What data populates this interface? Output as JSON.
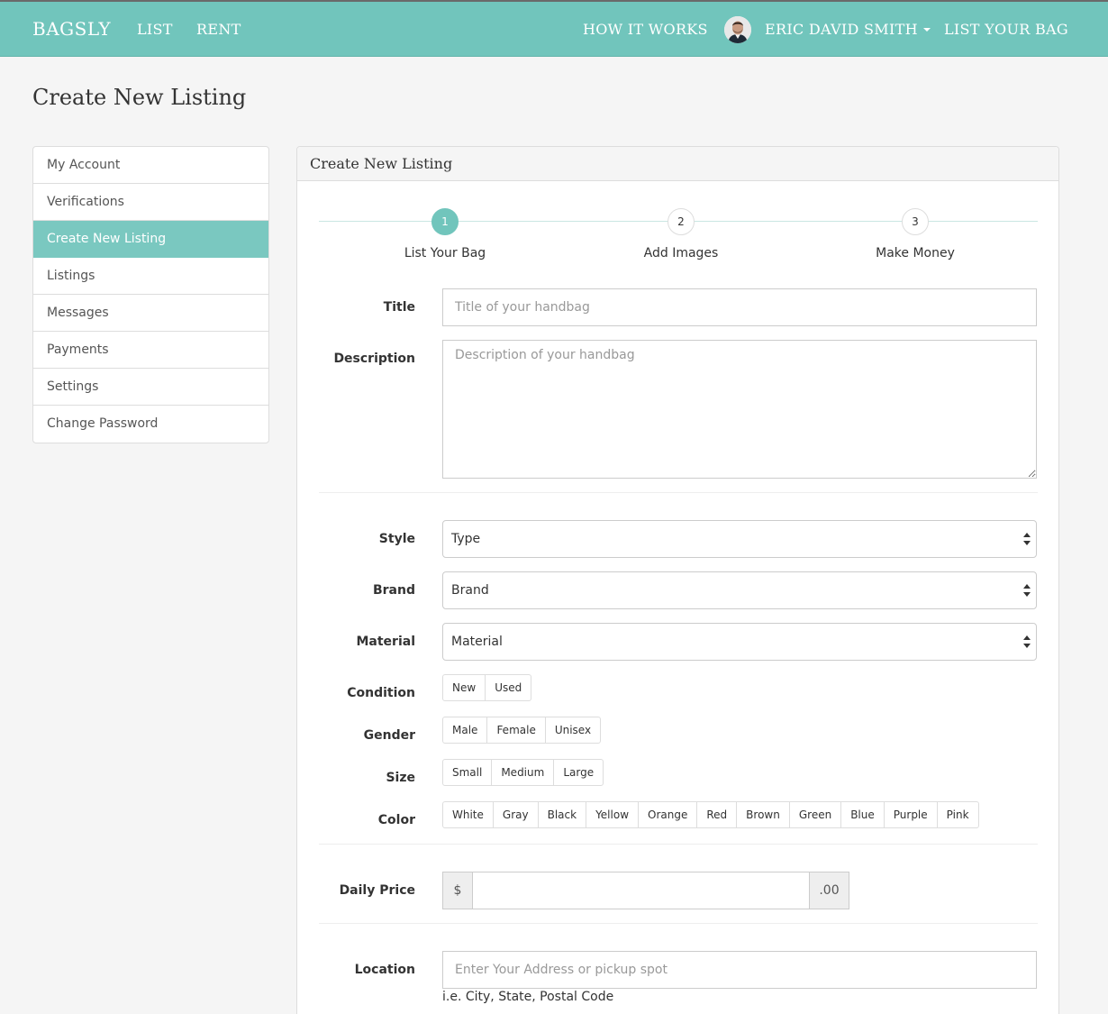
{
  "navbar": {
    "brand": "BAGSLY",
    "links": {
      "list": "LIST",
      "rent": "RENT",
      "how_it_works": "HOW IT WORKS",
      "user_name": "ERIC DAVID SMITH",
      "list_your_bag": "LIST YOUR BAG"
    },
    "accent_color": "#71c5bc"
  },
  "page": {
    "title": "Create New Listing"
  },
  "sidebar": {
    "items": [
      {
        "label": "My Account"
      },
      {
        "label": "Verifications"
      },
      {
        "label": "Create New Listing",
        "active": true
      },
      {
        "label": "Listings"
      },
      {
        "label": "Messages"
      },
      {
        "label": "Payments"
      },
      {
        "label": "Settings"
      },
      {
        "label": "Change Password"
      }
    ]
  },
  "panel": {
    "heading": "Create New Listing",
    "steps": [
      {
        "number": "1",
        "label": "List Your Bag",
        "active": true
      },
      {
        "number": "2",
        "label": "Add Images"
      },
      {
        "number": "3",
        "label": "Make Money"
      }
    ]
  },
  "form": {
    "title": {
      "label": "Title",
      "placeholder": "Title of your handbag"
    },
    "description": {
      "label": "Description",
      "placeholder": "Description of your handbag"
    },
    "style": {
      "label": "Style",
      "value": "Type"
    },
    "brand": {
      "label": "Brand",
      "value": "Brand"
    },
    "material": {
      "label": "Material",
      "value": "Material"
    },
    "condition": {
      "label": "Condition",
      "options": [
        "New",
        "Used"
      ]
    },
    "gender": {
      "label": "Gender",
      "options": [
        "Male",
        "Female",
        "Unisex"
      ]
    },
    "size": {
      "label": "Size",
      "options": [
        "Small",
        "Medium",
        "Large"
      ]
    },
    "color": {
      "label": "Color",
      "options": [
        "White",
        "Gray",
        "Black",
        "Yellow",
        "Orange",
        "Red",
        "Brown",
        "Green",
        "Blue",
        "Purple",
        "Pink"
      ]
    },
    "daily_price": {
      "label": "Daily Price",
      "prefix": "$",
      "suffix": ".00",
      "value": ""
    },
    "location": {
      "label": "Location",
      "placeholder": "Enter Your Address or pickup spot",
      "help": "i.e. City, State, Postal Code"
    }
  }
}
